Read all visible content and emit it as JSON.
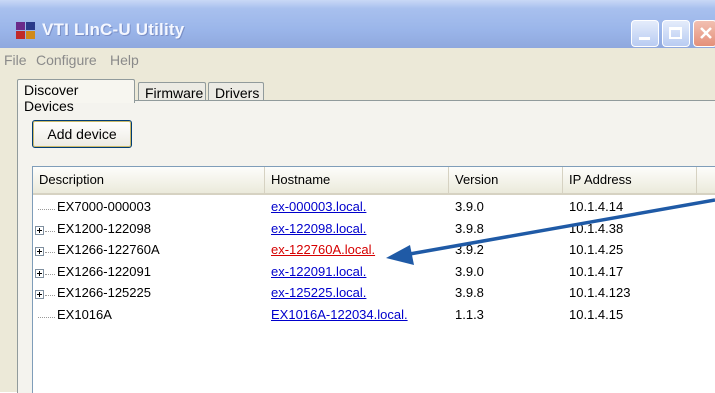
{
  "window": {
    "title": "VTI LInC-U Utility",
    "title_color": "#f4f7ff"
  },
  "menu": {
    "items": [
      "File",
      "Configure",
      "Help"
    ]
  },
  "tabs": [
    {
      "label": "Discover Devices",
      "active": true
    },
    {
      "label": "Firmware",
      "active": false
    },
    {
      "label": "Drivers",
      "active": false
    }
  ],
  "toolbar": {
    "add_label": "Add device"
  },
  "table": {
    "columns": [
      "Description",
      "Hostname",
      "Version",
      "IP Address"
    ],
    "rows": [
      {
        "description": "EX7000-000003",
        "hostname": "ex-000003.local.",
        "version": "3.9.0",
        "ip": "10.1.4.14",
        "expandable": false,
        "highlight": false
      },
      {
        "description": "EX1200-122098",
        "hostname": "ex-122098.local.",
        "version": "3.9.8",
        "ip": "10.1.4.38",
        "expandable": true,
        "highlight": false
      },
      {
        "description": "EX1266-122760A",
        "hostname": "ex-122760A.local.",
        "version": "3.9.2",
        "ip": "10.1.4.25",
        "expandable": true,
        "highlight": true
      },
      {
        "description": "EX1266-122091",
        "hostname": "ex-122091.local.",
        "version": "3.9.0",
        "ip": "10.1.4.17",
        "expandable": true,
        "highlight": false
      },
      {
        "description": "EX1266-125225",
        "hostname": "ex-125225.local.",
        "version": "3.9.8",
        "ip": "10.1.4.123",
        "expandable": true,
        "highlight": false
      },
      {
        "description": "EX1016A",
        "hostname": "EX1016A-122034.local.",
        "version": "1.1.3",
        "ip": "10.1.4.15",
        "expandable": false,
        "highlight": false
      }
    ]
  },
  "colors": {
    "link": "#0000cc",
    "highlight_link": "#d60000",
    "annotation_arrow": "#1f5aa6"
  }
}
